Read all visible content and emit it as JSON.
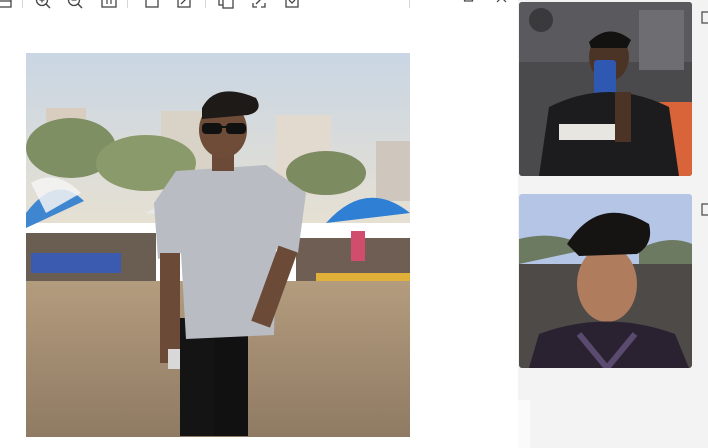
{
  "toolbar": {
    "icons": [
      "gallery-icon",
      "zoom-in-icon",
      "zoom-out-icon",
      "actual-size-icon",
      "crop-icon",
      "edit-icon",
      "copy-icon",
      "fit-icon",
      "save-icon",
      "more-icon"
    ],
    "more_label": "···"
  },
  "window": {
    "minimize": "–",
    "maximize": "▢",
    "close": "✕"
  },
  "colors": {
    "panel_bg": "#f3f3f3",
    "viewer_bg": "#ffffff",
    "icon": "#444444"
  }
}
